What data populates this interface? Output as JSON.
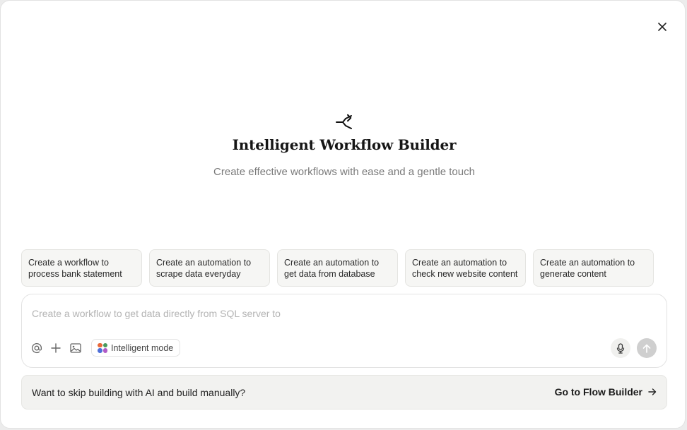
{
  "header": {
    "close_icon": "close-icon",
    "hero_icon": "workflow-split-icon",
    "title": "Intelligent Workflow Builder",
    "subtitle": "Create effective workflows with ease and a gentle touch"
  },
  "suggestions": [
    {
      "line1": "Create a workflow to",
      "line2": "process bank statement"
    },
    {
      "line1": "Create an automation to",
      "line2": "scrape data everyday"
    },
    {
      "line1": "Create an automation to",
      "line2": "get data from database"
    },
    {
      "line1": "Create an automation to",
      "line2": "check new website content"
    },
    {
      "line1": "Create an automation to",
      "line2": "generate content"
    }
  ],
  "composer": {
    "placeholder": "Create a workflow to get data directly from SQL server to",
    "value": "",
    "tools": [
      "at-mention-icon",
      "plus-icon",
      "image-icon"
    ],
    "mode_label": "Intelligent mode",
    "mode_colors": [
      "#e8683a",
      "#4a9a5c",
      "#4f6fd8",
      "#b05bc7"
    ],
    "mic_icon": "microphone-icon",
    "send_icon": "arrow-up-icon"
  },
  "manual": {
    "prompt": "Want to skip building with AI and build manually?",
    "link_label": "Go to Flow Builder",
    "link_icon": "arrow-right-icon"
  }
}
